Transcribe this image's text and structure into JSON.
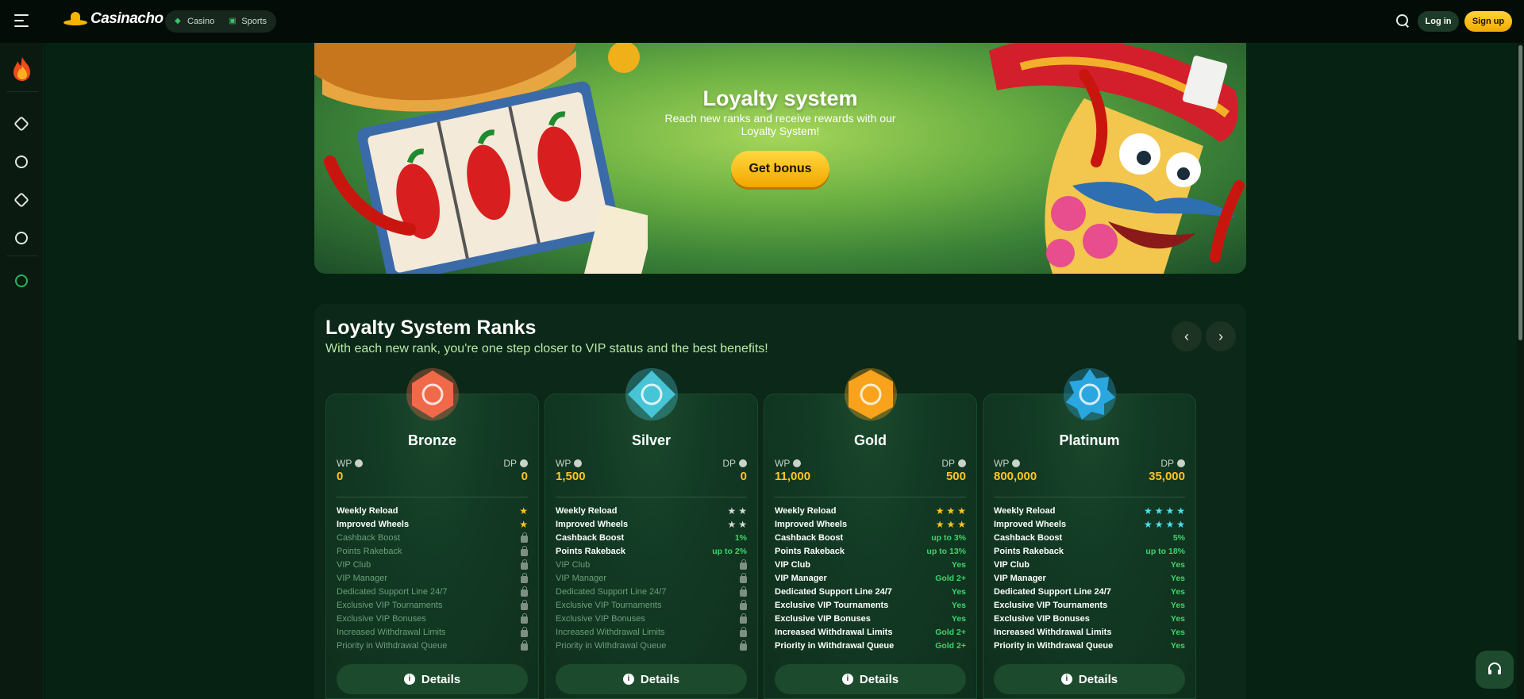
{
  "header": {
    "brand": "Casinacho",
    "modes": [
      {
        "label": "Casino"
      },
      {
        "label": "Sports"
      }
    ],
    "login_label": "Log in",
    "signup_label": "Sign up"
  },
  "banner": {
    "title": "Loyalty system",
    "subtitle": "Reach new ranks and receive rewards with our Loyalty System!",
    "cta_label": "Get bonus"
  },
  "ranks_section": {
    "title": "Loyalty System Ranks",
    "subtitle": "With each new rank, you're one step closer to VIP status and the best benefits!",
    "wp_label": "WP",
    "dp_label": "DP",
    "details_label": "Details",
    "perk_labels": [
      "Weekly Reload",
      "Improved Wheels",
      "Cashback Boost",
      "Points Rakeback",
      "VIP Club",
      "VIP Manager",
      "Dedicated Support Line 24/7",
      "Exclusive VIP Tournaments",
      "Exclusive VIP Bonuses",
      "Increased Withdrawal Limits",
      "Priority in Withdrawal Queue"
    ],
    "ranks": [
      {
        "name": "Bronze",
        "wp": "0",
        "dp": "0",
        "badge_color": "#f06a4a",
        "star_color": "#ffc424",
        "perks": [
          {
            "stars": 1
          },
          {
            "stars": 1
          },
          {
            "locked": true
          },
          {
            "locked": true
          },
          {
            "locked": true
          },
          {
            "locked": true
          },
          {
            "locked": true
          },
          {
            "locked": true
          },
          {
            "locked": true
          },
          {
            "locked": true
          },
          {
            "locked": true
          }
        ]
      },
      {
        "name": "Silver",
        "wp": "1,500",
        "dp": "0",
        "badge_color": "#47c4d6",
        "star_color": "#d5dcd7",
        "perks": [
          {
            "stars": 2
          },
          {
            "stars": 2
          },
          {
            "value": "1%"
          },
          {
            "value": "up to 2%"
          },
          {
            "locked": true
          },
          {
            "locked": true
          },
          {
            "locked": true
          },
          {
            "locked": true
          },
          {
            "locked": true
          },
          {
            "locked": true
          },
          {
            "locked": true
          }
        ]
      },
      {
        "name": "Gold",
        "wp": "11,000",
        "dp": "500",
        "badge_color": "#f8a31b",
        "star_color": "#ffc424",
        "perks": [
          {
            "stars": 3
          },
          {
            "stars": 3
          },
          {
            "value": "up to 3%"
          },
          {
            "value": "up to 13%"
          },
          {
            "value": "Yes"
          },
          {
            "value": "Gold 2+"
          },
          {
            "value": "Yes"
          },
          {
            "value": "Yes"
          },
          {
            "value": "Yes"
          },
          {
            "value": "Gold 2+"
          },
          {
            "value": "Gold 2+"
          }
        ]
      },
      {
        "name": "Platinum",
        "wp": "800,000",
        "dp": "35,000",
        "badge_color": "#2aa7e0",
        "star_color": "#4fe0f0",
        "perks": [
          {
            "stars": 4
          },
          {
            "stars": 4
          },
          {
            "value": "5%"
          },
          {
            "value": "up to 18%"
          },
          {
            "value": "Yes"
          },
          {
            "value": "Yes"
          },
          {
            "value": "Yes"
          },
          {
            "value": "Yes"
          },
          {
            "value": "Yes"
          },
          {
            "value": "Yes"
          },
          {
            "value": "Yes"
          }
        ]
      }
    ]
  },
  "colors": {
    "accent": "#ffc424",
    "brand_green": "#062212",
    "positive": "#3ed46b"
  }
}
